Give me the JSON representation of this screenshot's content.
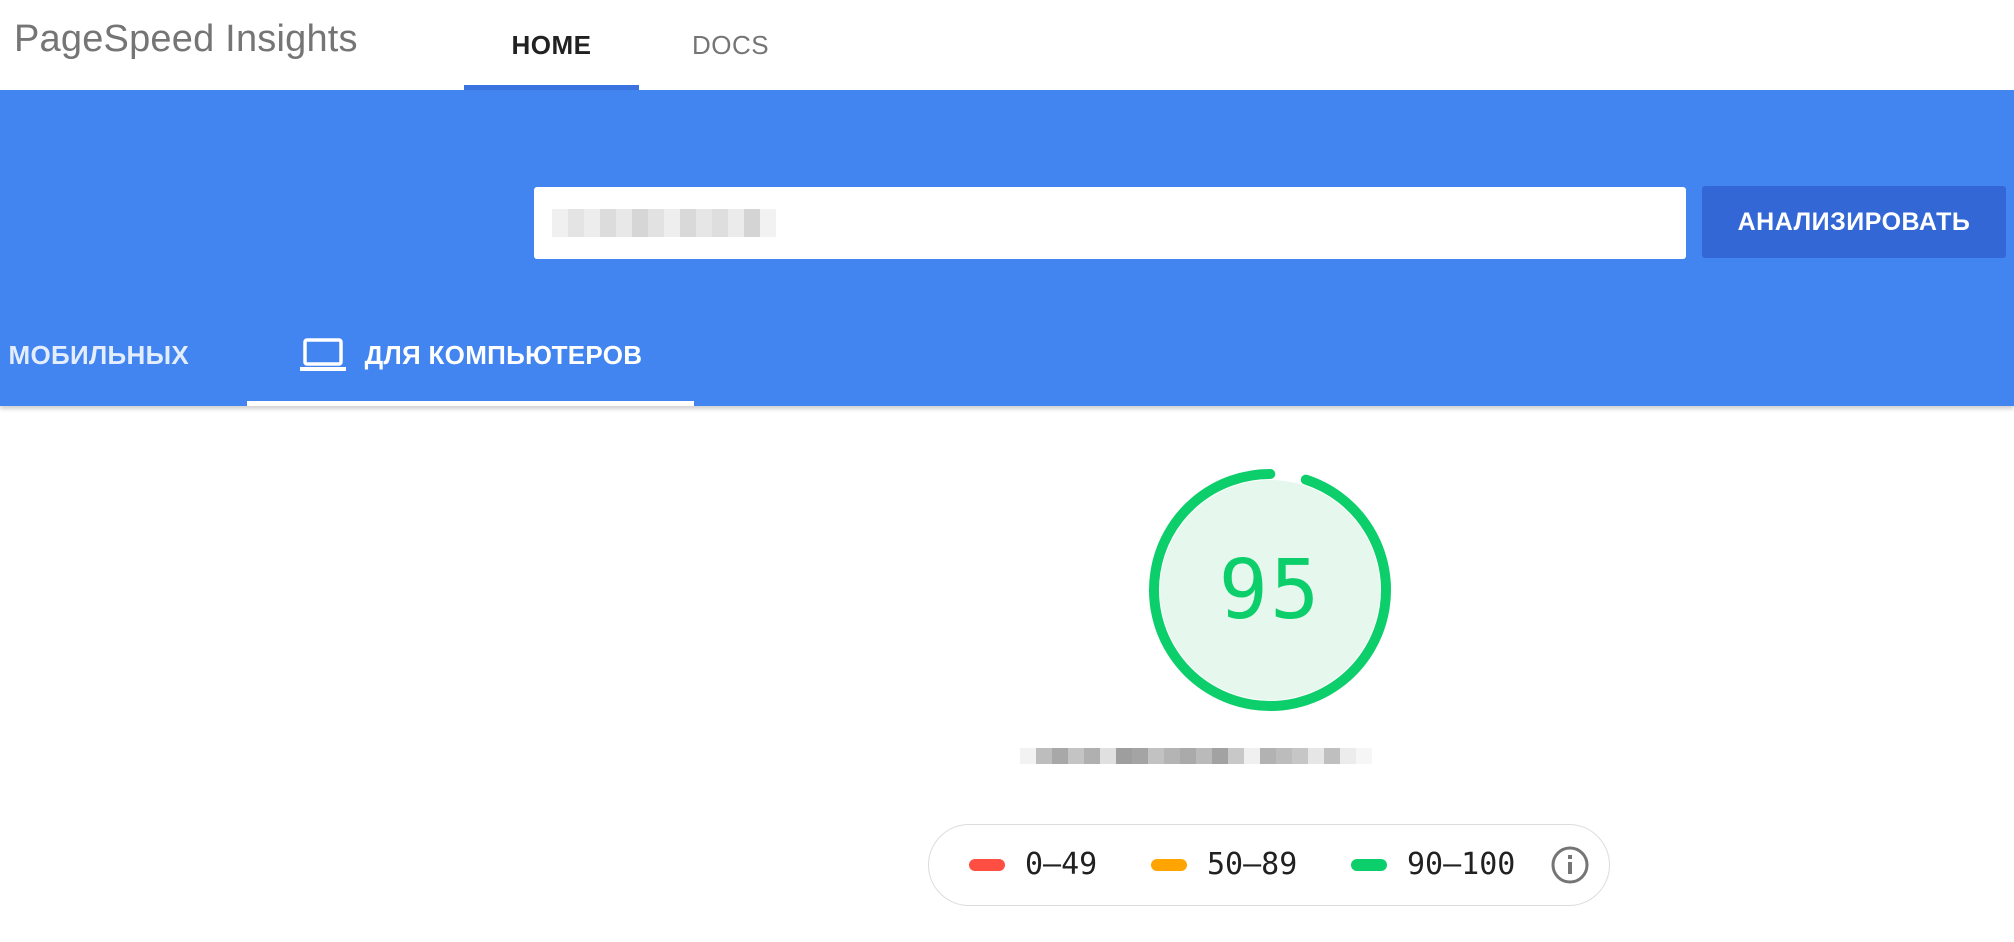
{
  "header": {
    "app_title": "PageSpeed Insights",
    "nav": [
      {
        "label": "HOME",
        "active": true
      },
      {
        "label": "DOCS",
        "active": false
      }
    ]
  },
  "search": {
    "url_value": "",
    "analyze_label": "АНАЛИЗИРОВАТЬ"
  },
  "device_tabs": [
    {
      "label": "Я МОБИЛЬНЫХ",
      "icon": "smartphone-icon",
      "active": false
    },
    {
      "label": "ДЛЯ КОМПЬЮТЕРОВ",
      "icon": "laptop-icon",
      "active": true
    }
  ],
  "score": {
    "value": "95",
    "fraction": 0.95,
    "color": "#0cce6b"
  },
  "legend": {
    "items": [
      {
        "label": "0–49",
        "color": "#ff4e42"
      },
      {
        "label": "50–89",
        "color": "#ffa400"
      },
      {
        "label": "90–100",
        "color": "#0cce6b"
      }
    ],
    "info_icon": "info-icon"
  },
  "colors": {
    "brand_blue": "#4285f0",
    "button_blue": "#3367d6",
    "tab_underline": "#3b74e0"
  }
}
